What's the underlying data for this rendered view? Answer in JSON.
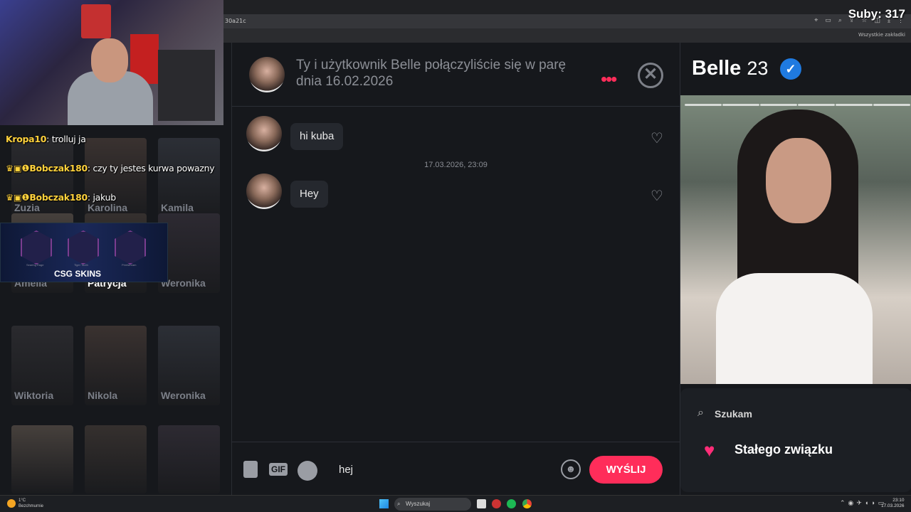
{
  "browser": {
    "url_fragment": "30a21c",
    "bookmarks_label": "Wszystkie zakładki"
  },
  "stream": {
    "sub_counter": "Suby: 317"
  },
  "stream_chat": [
    {
      "user": "Kropa10",
      "message": ": trolluj ja",
      "badges": false
    },
    {
      "user": "Bobczak180",
      "message": ": czy ty jestes kurwa powazny",
      "badges": true
    },
    {
      "user": "Bobczak180",
      "message": ": jakub",
      "badges": true
    }
  ],
  "left_grid": {
    "rows": [
      [
        "Zuzia",
        "Karolina",
        "Kamila"
      ],
      [
        "Amelia",
        "Patrycja",
        "Weronika"
      ],
      [
        "Wiktoria",
        "Nikola",
        "Weronika"
      ],
      [
        "",
        "",
        ""
      ]
    ],
    "active": "Patrycja"
  },
  "skins_banner": {
    "label": "CSG SKINS",
    "items": [
      "Searing Rage",
      "Tiger Tooth",
      "Printstream"
    ]
  },
  "chat": {
    "header_text": "Ty i użytkownik Belle połączyliście się w parę dnia 16.02.2026",
    "messages": [
      {
        "text": "hi kuba"
      },
      {
        "text": "Hey"
      }
    ],
    "date_separator": "17.03.2026, 23:09",
    "composer_value": "hej",
    "gif_label": "GIF",
    "send_label": "WYŚLIJ"
  },
  "profile": {
    "name": "Belle",
    "age": "23",
    "search_label": "Szukam",
    "relationship": "Stałego związku",
    "photo_count": 6
  },
  "taskbar": {
    "weather_temp": "1°C",
    "weather_desc": "Bezchmurnie",
    "search_placeholder": "Wyszukaj",
    "time": "23:10",
    "date": "17.03.2026"
  },
  "colors": {
    "accent": "#ff2d5a",
    "verified": "#1f7ae0",
    "username": "#ffd23c"
  }
}
